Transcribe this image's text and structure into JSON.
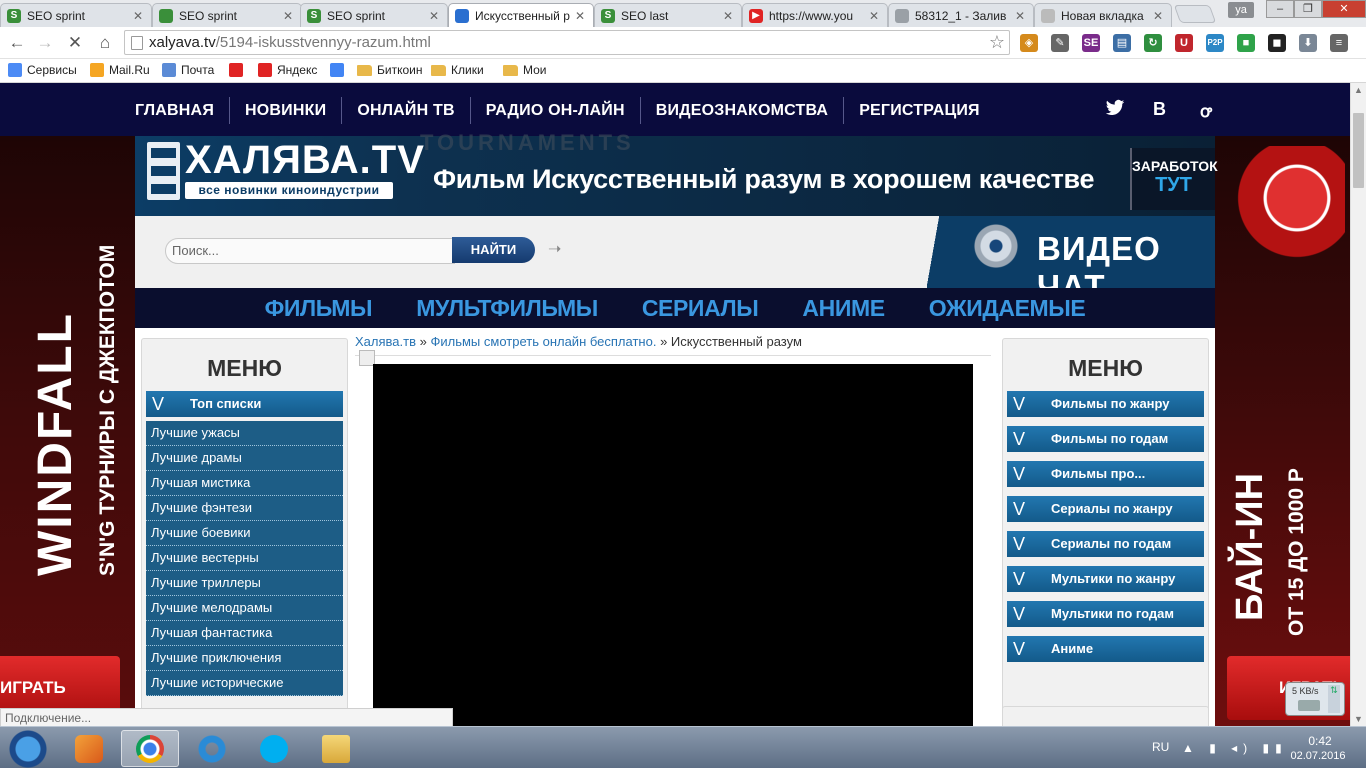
{
  "browser": {
    "tabs": [
      {
        "title": "SEO sprint",
        "fav_color": "#3a8f3a",
        "fav_glyph": "S",
        "active": false
      },
      {
        "title": "SEO sprint",
        "fav_color": "#3a8f3a",
        "fav_glyph": "",
        "active": false
      },
      {
        "title": "SEO sprint",
        "fav_color": "#3a8f3a",
        "fav_glyph": "S",
        "active": false
      },
      {
        "title": "Искусственный р",
        "fav_color": "#2a6fd0",
        "fav_glyph": "",
        "active": true
      },
      {
        "title": "SEO last",
        "fav_color": "#3a8f3a",
        "fav_glyph": "S",
        "active": false
      },
      {
        "title": "https://www.you",
        "fav_color": "#e02424",
        "fav_glyph": "▶",
        "active": false
      },
      {
        "title": "58312_1 - Залив",
        "fav_color": "#9aa0a6",
        "fav_glyph": "",
        "active": false
      },
      {
        "title": "Новая вкладка",
        "fav_color": "#bbbbbb",
        "fav_glyph": "",
        "active": false
      }
    ],
    "user_badge": "ya",
    "window_controls": {
      "minimize": "–",
      "maximize": "❐",
      "close": "✕"
    },
    "url_host": "xalyava.tv",
    "url_path": "/5194-iskusstvennyy-razum.html",
    "extensions": [
      {
        "glyph": "◈",
        "color": "#d58a1c"
      },
      {
        "glyph": "✎",
        "color": "#666666"
      },
      {
        "glyph": "SE",
        "color": "#7a2b8a"
      },
      {
        "glyph": "▤",
        "color": "#3c6ea5"
      },
      {
        "glyph": "↻",
        "color": "#2f8f3f"
      },
      {
        "glyph": "U",
        "color": "#c0262d"
      },
      {
        "glyph": "P2P",
        "color": "#2d88c6"
      },
      {
        "glyph": "■",
        "color": "#2fa34a"
      },
      {
        "glyph": "◼",
        "color": "#222222"
      },
      {
        "glyph": "⬇",
        "color": "#7a8796"
      },
      {
        "glyph": "≡",
        "color": "#666666"
      }
    ],
    "bookmarks": [
      {
        "label": "Сервисы",
        "type": "apps"
      },
      {
        "label": "Mail.Ru",
        "type": "mail"
      },
      {
        "label": "Почта",
        "type": "envelope"
      },
      {
        "label": "",
        "type": "youtube"
      },
      {
        "label": "Яндекс",
        "type": "yandex"
      },
      {
        "label": "",
        "type": "google"
      },
      {
        "label": "Биткоин",
        "type": "folder"
      },
      {
        "label": "Клики",
        "type": "folder"
      },
      {
        "label": "Мои",
        "type": "folder"
      }
    ],
    "status_text": "Подключение..."
  },
  "site": {
    "topnav": [
      "ГЛАВНАЯ",
      "НОВИНКИ",
      "ОНЛАЙН ТВ",
      "РАДИО ОН-ЛАЙН",
      "ВИДЕОЗНАКОМСТВА",
      "РЕГИСТРАЦИЯ"
    ],
    "social": {
      "twitter": "twitter-icon",
      "vk": "В",
      "ok": "ok-icon"
    },
    "logo_name": "ХАЛЯВА.TV",
    "logo_tagline": "все новинки киноиндустрии",
    "ad_header_text": "TOURNAMENTS",
    "page_title": "Фильм Искусственный разум в хорошем качестве",
    "earn": {
      "line1": "ЗАРАБОТОК",
      "line2": "ТУТ"
    },
    "search": {
      "placeholder": "Поиск...",
      "button": "НАЙТИ"
    },
    "videochat": "ВИДЕО ЧАТ",
    "categories": [
      "ФИЛЬМЫ",
      "МУЛЬТФИЛЬМЫ",
      "СЕРИАЛЫ",
      "АНИМЕ",
      "ОЖИДАЕМЫЕ"
    ],
    "left_menu": {
      "title": "МЕНЮ",
      "block": "Топ списки",
      "items": [
        "Лучшие ужасы",
        "Лучшие драмы",
        "Лучшая мистика",
        "Лучшие фэнтези",
        "Лучшие боевики",
        "Лучшие вестерны",
        "Лучшие триллеры",
        "Лучшие мелодрамы",
        "Лучшая фантастика",
        "Лучшие приключения",
        "Лучшие исторические"
      ]
    },
    "right_menu": {
      "title": "МЕНЮ",
      "blocks": [
        "Фильмы по жанру",
        "Фильмы по годам",
        "Фильмы про...",
        "Сериалы по жанру",
        "Сериалы по годам",
        "Мультики по жанру",
        "Мультики по годам",
        "Аниме"
      ]
    },
    "breadcrumb": {
      "home": "Халява.тв",
      "sep": "»",
      "section": "Фильмы смотреть онлайн бесплатно.",
      "current": "Искусственный разум"
    },
    "ads": {
      "left_big": "WINDFALL",
      "left_sub": "S'N'G ТУРНИРЫ С ДЖЕКПОТОМ",
      "left_button": "ИГРАТЬ",
      "right_big": "БАЙ-ИН",
      "right_sub": "ОТ 15 ДО 1000 Р",
      "right_button": "ИГРАТЬ"
    }
  },
  "netwidget": {
    "speed": "5 KB/s"
  },
  "taskbar": {
    "apps": [
      "media-player",
      "chrome",
      "internet-explorer",
      "skype",
      "explorer"
    ],
    "lang": "RU",
    "time": "0:42",
    "date": "02.07.2016"
  }
}
